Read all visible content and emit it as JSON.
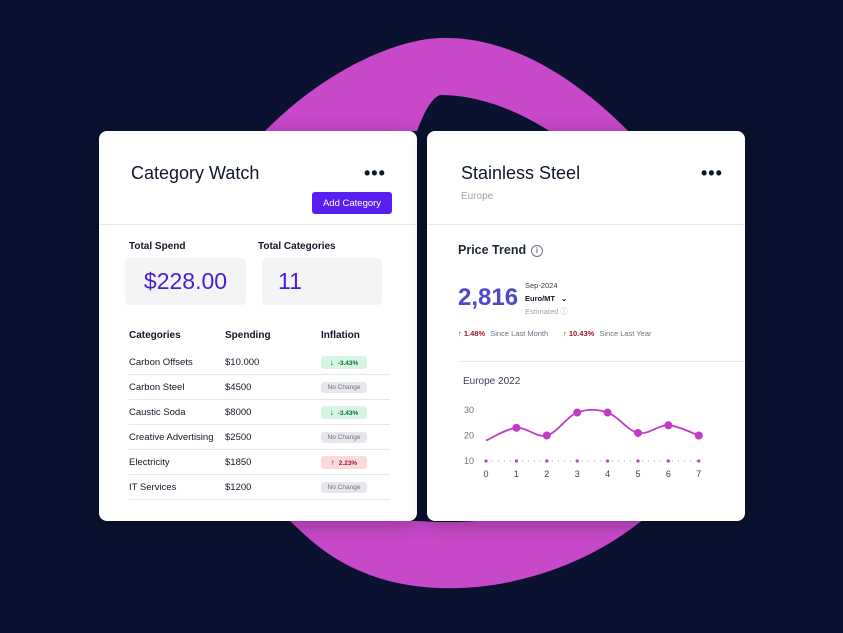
{
  "category_watch": {
    "title": "Category Watch",
    "add_button": "Add Category",
    "total_spend_label": "Total Spend",
    "total_spend_value": "$228.00",
    "total_categories_label": "Total Categories",
    "total_categories_value": "11",
    "columns": [
      "Categories",
      "Spending",
      "Inflation"
    ],
    "rows": [
      {
        "category": "Carbon Offsets",
        "spending": "$10.000",
        "inflation": "-3.43%",
        "trend": "down"
      },
      {
        "category": "Carbon Steel",
        "spending": "$4500",
        "inflation": "No Change",
        "trend": "none"
      },
      {
        "category": "Caustic Soda",
        "spending": "$8000",
        "inflation": "-3.43%",
        "trend": "down"
      },
      {
        "category": "Creative Advertising",
        "spending": "$2500",
        "inflation": "No Change",
        "trend": "none"
      },
      {
        "category": "Electricity",
        "spending": "$1850",
        "inflation": "2.23%",
        "trend": "up"
      },
      {
        "category": "IT Services",
        "spending": "$1200",
        "inflation": "No Change",
        "trend": "none"
      }
    ]
  },
  "stainless_steel": {
    "title": "Stainless Steel",
    "region": "Europe",
    "price_trend_label": "Price Trend",
    "price": "2,816",
    "date": "Sep-2024",
    "unit": "Euro/MT",
    "estimated": "Estimated",
    "change_month_pct": "1.48%",
    "change_month_label": "Since Last Month",
    "change_year_pct": "10.43%",
    "change_year_label": "Since Last Year"
  },
  "colors": {
    "accent": "#5a1ff0",
    "blob": "#c748c8",
    "background": "#0a1230",
    "line": "#c23bc6"
  },
  "chart_data": {
    "type": "line",
    "title": "Europe 2022",
    "x": [
      0,
      1,
      2,
      3,
      4,
      5,
      6,
      7
    ],
    "series": [
      {
        "values": [
          18,
          23,
          20,
          29,
          29,
          21,
          24,
          20
        ]
      },
      {
        "values": [
          10,
          10,
          10,
          10,
          10,
          10,
          10,
          10
        ]
      }
    ],
    "y_ticks": [
      10,
      20,
      30
    ],
    "ylim": [
      10,
      30
    ],
    "grid": false
  }
}
